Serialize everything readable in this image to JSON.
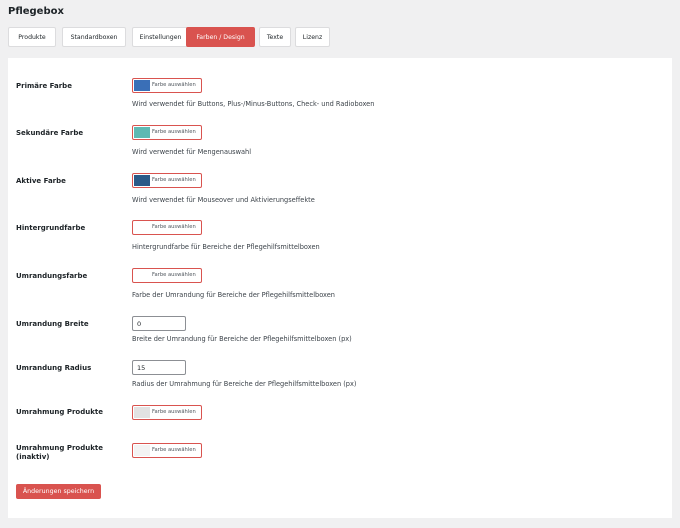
{
  "page": {
    "title": "Pflegebox"
  },
  "tabs": [
    {
      "label": "Produkte"
    },
    {
      "label": "Standardboxen"
    },
    {
      "label": "Einstellungen"
    },
    {
      "label": "Farben / Design",
      "active": true
    },
    {
      "label": "Texte"
    },
    {
      "label": "Lizenz"
    }
  ],
  "settings": {
    "primary_color": {
      "label": "Primäre Farbe",
      "button_label": "Farbe auswählen",
      "color": "#3a6fb7",
      "description": "Wird verwendet für Buttons, Plus-/Minus-Buttons, Check- und Radioboxen"
    },
    "secondary_color": {
      "label": "Sekundäre Farbe",
      "button_label": "Farbe auswählen",
      "color": "#5db9b3",
      "description": "Wird verwendet für Mengenauswahl"
    },
    "active_color": {
      "label": "Aktive Farbe",
      "button_label": "Farbe auswählen",
      "color": "#2b5a88",
      "description": "Wird verwendet für Mouseover und Aktivierungseffekte"
    },
    "background_color": {
      "label": "Hintergrundfarbe",
      "button_label": "Farbe auswählen",
      "color": "#ffffff",
      "description": "Hintergrundfarbe für Bereiche der Pflegehilfsmittelboxen"
    },
    "border_color": {
      "label": "Umrandungsfarbe",
      "button_label": "Farbe auswählen",
      "color": "#ffffff",
      "description": "Farbe der Umrandung für Bereiche der Pflegehilfsmittelboxen"
    },
    "border_width": {
      "label": "Umrandung Breite",
      "value": "0",
      "description": "Breite der Umrandung für Bereiche der Pflegehilfsmittelboxen (px)"
    },
    "border_radius": {
      "label": "Umrandung Radius",
      "value": "15",
      "description": "Radius der Umrahmung für Bereiche der Pflegehilfsmittelboxen (px)"
    },
    "frame_products": {
      "label": "Umrahmung Produkte",
      "button_label": "Farbe auswählen",
      "color": "#e2e2e2"
    },
    "frame_products_inactive": {
      "label": "Umrahmung Produkte (inaktiv)",
      "button_label": "Farbe auswählen",
      "color": "#f3f3f3"
    }
  },
  "save_button": {
    "label": "Änderungen speichern"
  },
  "colors": {
    "accent": "#d9534f",
    "page_bg": "#f0f0f1",
    "panel_bg": "#ffffff"
  }
}
